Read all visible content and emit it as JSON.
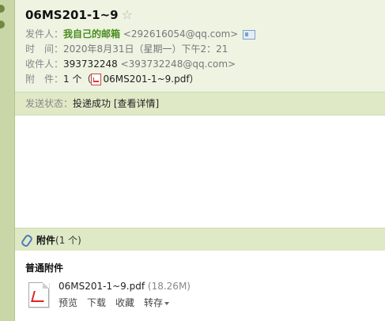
{
  "mail": {
    "subject": "06MS201-1~9",
    "star_icon": "☆",
    "from_label": "发件人：",
    "from_name": "我自己的邮箱",
    "from_email": "<292616054@qq.com>",
    "time_label": "时　间：",
    "time_value": "2020年8月31日（星期一）下午2：21",
    "to_label": "收件人：",
    "to_name": "393732248",
    "to_email": "<393732248@qq.com>",
    "attach_label": "附　件：",
    "attach_count": "1 个（",
    "attach_file": "06MS201-1~9.pdf",
    "attach_close": "）"
  },
  "status": {
    "label": "发送状态：",
    "value": "投递成功",
    "details_link": "[查看详情]"
  },
  "attachments": {
    "title": "附件",
    "count": "(1 个)",
    "group_title": "普通附件",
    "file_name": "06MS201-1~9.pdf",
    "file_size": "(18.26M)",
    "actions": {
      "preview": "预览",
      "download": "下载",
      "favorite": "收藏",
      "forward": "转存"
    }
  }
}
